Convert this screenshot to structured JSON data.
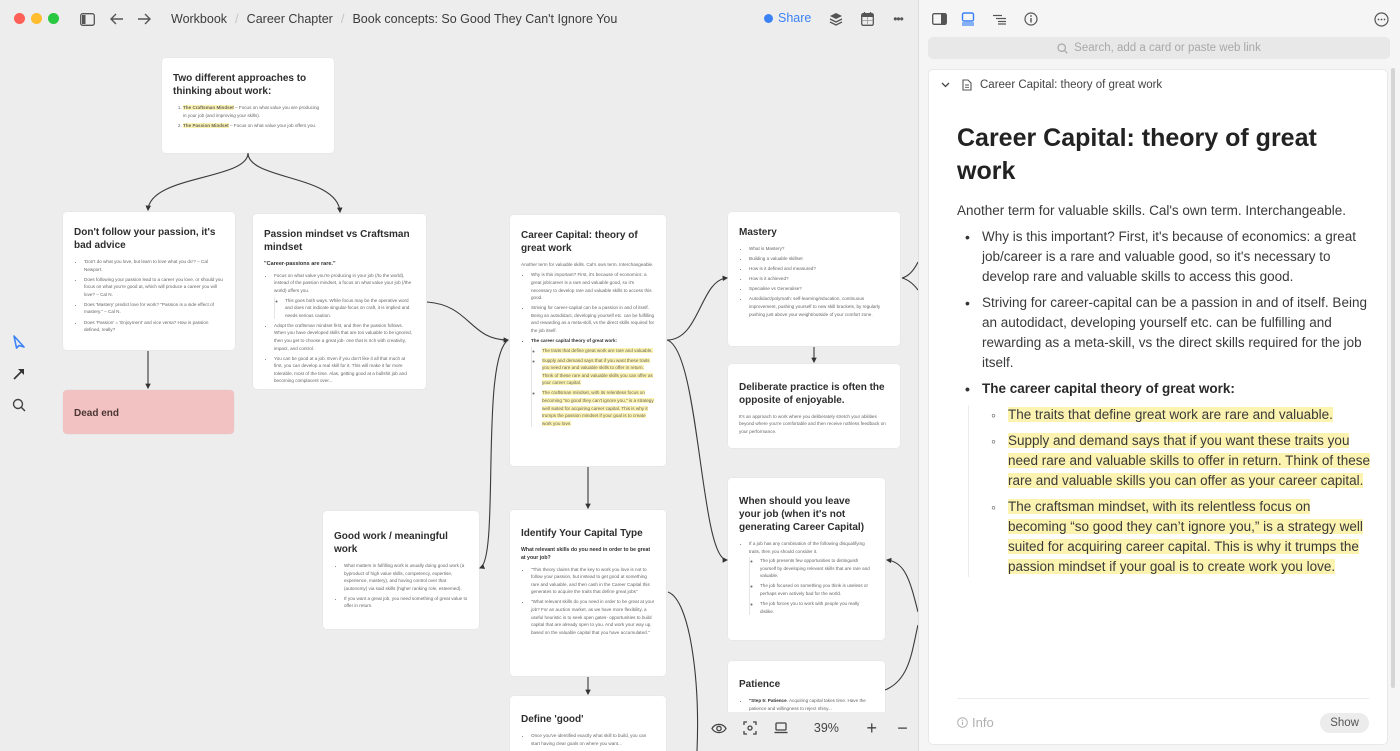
{
  "window": {
    "breadcrumb": [
      "Workbook",
      "Career Chapter",
      "Book concepts: So Good They Can't Ignore You"
    ],
    "share_label": "Share",
    "accent_color": "#3b82f6"
  },
  "icons": {
    "sidebar_toggle": "sidebar-icon",
    "back": "←",
    "forward": "→",
    "layers": "layers-icon",
    "calendar": "calendar-icon",
    "more": "•••"
  },
  "canvas": {
    "cards": {
      "approaches": {
        "title": "Two different approaches to thinking about work:",
        "items": [
          {
            "highlight": "The Craftsman Mindset",
            "text": " – Focus on what value you are producing in your job (and improving your skills)."
          },
          {
            "highlight": "The Passion Mindset",
            "text": " – Focus on what value your job offers you."
          }
        ]
      },
      "dont_follow": {
        "title": "Don't follow your passion, it's bad advice",
        "items": [
          "'Don't do what you love, but learn to love what you do'? – Cal Newport.",
          "Does following your passion lead to a career you love, or should you focus on what you're good at, which will produce a career you will love? – Cal N.",
          "Does 'Mastery' predict love for work? \"Passion is a side effect of mastery.\" – Cal N.",
          "Does 'Passion' = 'Enjoyment' and vice versa? How is passion defined, really?"
        ]
      },
      "dead_end": {
        "title": "Dead end"
      },
      "passion_vs_craftsman": {
        "title": "Passion mindset vs Craftsman mindset",
        "quote": "\"Career-passions are rare.\"",
        "items": [
          "Focus on what value you're producing in your job (/to the world), instead of the passion mindset, a focus on what value your job (/the world) offers you.",
          "Adopt the craftsman mindset first, and then the passion follows. When you have developed skills that are too valuable to be ignored, then you get to choose a great job- one that is rich with creativity, impact, and control.",
          "You can be good at a job. Even if you don't like it all that much at first, you can develop a real skill for it. This will make it far more tolerable, most of the time. Alas, getting good at a bullshit job and becoming complacent over..."
        ],
        "subitem": "This goes both ways. While focus may be the operative word and does not indicate singular-focus on craft, it is implied and needs serious caution."
      },
      "career_capital": {
        "title": "Career Capital: theory of great work",
        "intro": "Another term for valuable skills. Cal's own term. Interchangeable.",
        "items": [
          "Why is this important? First, it's because of economics: a great job/career is a rare and valuable good, so it's necessary to develop rare and valuable skills to access this good.",
          "Striving for career-capital can be a passion in and of itself. Being an autodidact, developing yourself etc. can be fulfilling and rewarding as a meta-skill, vs the direct skills required for the job itself.",
          "The career capital theory of great work:"
        ],
        "subitems": [
          "The traits that define great work are rare and valuable.",
          "Supply and demand says that if you want these traits you need rare and valuable skills to offer in return. Think of these rare and valuable skills you can offer as your career capital.",
          "The craftsman mindset, with its relentless focus on becoming \"so good they can't ignore you,\" is a strategy well suited for acquiring career capital. This is why it trumps the passion mindset if your goal is to create work you love."
        ]
      },
      "mastery": {
        "title": "Mastery",
        "items": [
          "What is Mastery?",
          "Building a valuable skillset",
          "How is it defined and measured?",
          "How is it achieved?",
          "Specialise vs Generalise?",
          "Autodidact/polymath: self-learning/education, continuous improvement, pushing yourself to new skill brackets, by regularly pushing just above your weight/outside of your comfort zone."
        ]
      },
      "deliberate": {
        "title": "Deliberate practice is often the opposite of enjoyable.",
        "text": "It's an approach to work where you deliberately stretch your abilities beyond where you're comfortable and then receive ruthless feedback on your performance."
      },
      "good_work": {
        "title": "Good work / meaningful work",
        "items": [
          "What matters in fulfilling work is usually doing good work (a byproduct of high value skills, competency, expertise, experience, mastery), and having control over that (autonomy) via said skills (higher ranking role, esteemed).",
          "If you want a great job, you need something of great value to offer in return."
        ]
      },
      "identify": {
        "title": "Identify Your Capital Type",
        "question": "What relevant skills do you need in order to be great at your job?",
        "items": [
          "\"This theory claims that the key to work you love is not to follow your passion, but instead to get good at something rare and valuable, and then cash in the Career Capital this generates to acquire the traits that define great jobs\"",
          "\"What relevant skills do you need in order to be great at your job? For an auction market, as we have more flexibility, a useful heuristic is to seek open gates- opportunities to build capital that are already open to you. And work your way up, based on the valuable capital that you have accumulated.\""
        ]
      },
      "leave_job": {
        "title": "When should you leave your job (when it's not generating Career Capital)",
        "item": "If a job has any combination of the following disqualifying traits, then you should consider it.",
        "subitems": [
          "The job presents few opportunities to distinguish yourself by developing relevant skills that are rare and valuable.",
          "The job focused on something you think is useless or perhaps even actively bad for the world.",
          "The job forces you to work with people you really dislike."
        ]
      },
      "define_good": {
        "title": "Define 'good'",
        "item": "Once you've identified exactly what skill to build, you can start having clear goals on where you want..."
      },
      "patience": {
        "title": "Patience",
        "bold": "\"Step 5: Patience",
        "item": ". Acquiring capital takes time. Have the patience and willingness to reject shiny..."
      }
    },
    "zoom_level": "39%",
    "zoom_in": "+",
    "zoom_out": "−"
  },
  "right_pane": {
    "search_placeholder": "Search, add a card or paste web link",
    "doc_header": "Career Capital: theory of great work",
    "doc_title": "Career Capital: theory of great work",
    "intro": "Another term for valuable skills. Cal's own term. Interchangeable.",
    "bullets": [
      "Why is this important? First, it's because of economics: a great job/career is a rare and valuable good, so it's necessary to develop rare and valuable skills to access this good.",
      "Striving for career-capital can be a passion in and of itself. Being an autodidact, developing yourself etc. can be fulfilling and rewarding as a meta-skill, vs the direct skills required for the job itself.",
      "The career capital theory of great work:"
    ],
    "sub_bullets": [
      "The traits that define great work are rare and valuable.",
      "Supply and demand says that if you want these traits you need rare and valuable skills to offer in return. Think of these rare and valuable skills you can offer as your career capital.",
      "The craftsman mindset, with its relentless focus on becoming “so good they can’t ignore you,” is a strategy well suited for acquiring career capital. This is why it trumps the passion mindset if your goal is to create work you love."
    ],
    "info_label": "Info",
    "show_label": "Show",
    "highlight_color": "#fdf3b0"
  }
}
